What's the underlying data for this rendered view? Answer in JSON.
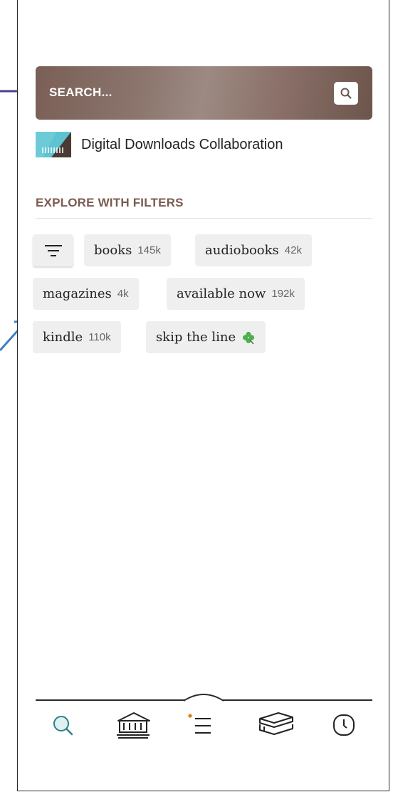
{
  "search": {
    "label": "SEARCH..."
  },
  "library": {
    "name": "Digital Downloads Collaboration"
  },
  "filters": {
    "title": "EXPLORE WITH FILTERS",
    "chips": [
      {
        "label": "books",
        "count": "145k"
      },
      {
        "label": "audiobooks",
        "count": "42k"
      },
      {
        "label": "magazines",
        "count": "4k"
      },
      {
        "label": "available now",
        "count": "192k"
      },
      {
        "label": "kindle",
        "count": "110k"
      },
      {
        "label": "skip the line",
        "count": ""
      }
    ]
  },
  "tabs": [
    {
      "icon": "search-icon"
    },
    {
      "icon": "library-icon"
    },
    {
      "icon": "menu-icon"
    },
    {
      "icon": "books-stack-icon"
    },
    {
      "icon": "clock-icon"
    }
  ],
  "colors": {
    "accent": "#2f7f86",
    "brand_brown": "#7a5b50",
    "arrow": "#4a3f8f",
    "arrow2": "#3b7fc4",
    "notify_dot": "#e07a1a",
    "clover": "#4caf50"
  }
}
